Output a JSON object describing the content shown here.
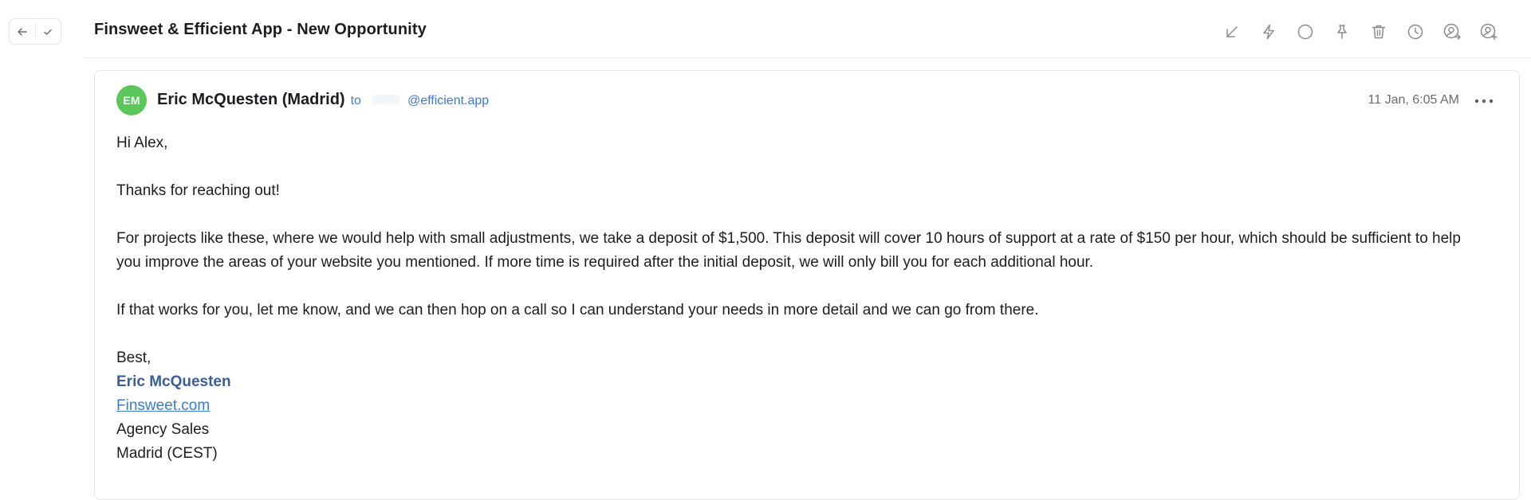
{
  "thread": {
    "subject": "Finsweet & Efficient App - New Opportunity"
  },
  "navigation": {
    "back_icon": "arrow-left-icon",
    "done_icon": "check-icon"
  },
  "toolbar": {
    "icons": [
      "arrow-down-left-icon",
      "lightning-icon",
      "circle-icon",
      "pin-icon",
      "trash-icon",
      "clock-icon",
      "user-forward-icon",
      "user-add-icon"
    ]
  },
  "message": {
    "avatar_initials": "EM",
    "avatar_color": "#5bc75a",
    "sender": "Eric McQuesten (Madrid)",
    "to_label": "to",
    "recipient": "@efficient.app",
    "timestamp": "11 Jan, 6:05 AM",
    "body": {
      "greeting": "Hi Alex,",
      "p1": "Thanks for reaching out!",
      "p2": "For projects like these, where we would help with small adjustments, we take a deposit of $1,500. This deposit will cover 10 hours of support at a rate of $150 per hour, which should be sufficient to help you improve the areas of your website you mentioned. If more time is required after the initial deposit, we will only bill you for each additional hour.",
      "p3": "If that works for you, let me know, and we can then hop on a call so I can understand your needs in more detail and we can go from there."
    },
    "signature": {
      "closing": "Best,",
      "name": "Eric McQuesten",
      "link": "Finsweet.com",
      "role": "Agency Sales",
      "location": "Madrid (CEST)"
    }
  },
  "colors": {
    "accent_link": "#3a7bd5",
    "signature_name": "#3a5d9c",
    "icon_gray": "#8a8a90"
  }
}
